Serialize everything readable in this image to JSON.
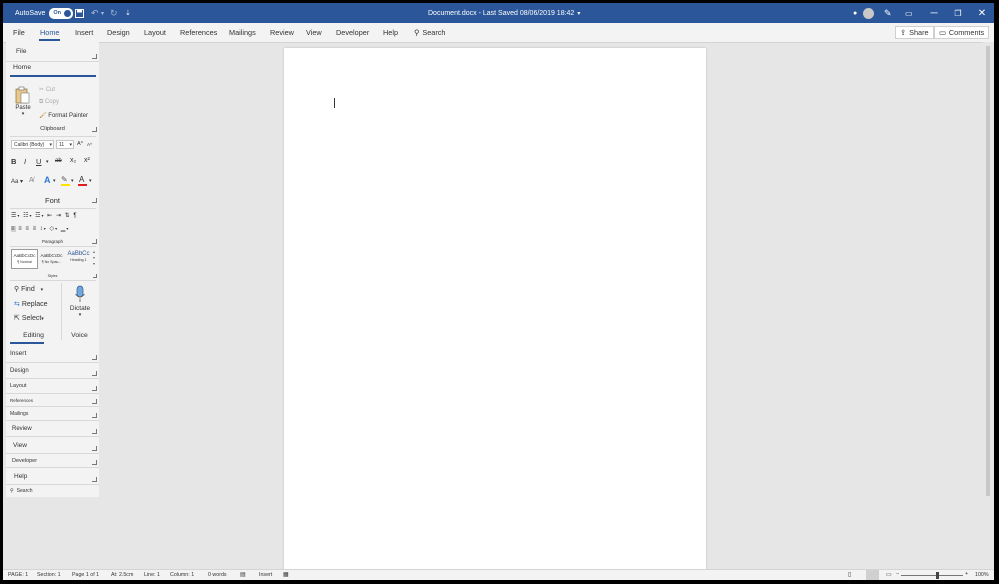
{
  "titlebar": {
    "autosave_label": "AutoSave",
    "autosave_state": "On",
    "document_title": "Document.docx - Last Saved 08/06/2019 18:42",
    "title_dropdown_icon": "chevron-down-icon",
    "avatar_initials": "",
    "buttons": [
      "minimize",
      "restore",
      "close"
    ]
  },
  "tabs": {
    "items": [
      "File",
      "Home",
      "Insert",
      "Design",
      "Layout",
      "References",
      "Mailings",
      "Review",
      "View",
      "Developer",
      "Help"
    ],
    "active": "Home",
    "search_label": "Search",
    "share_label": "Share",
    "comments_label": "Comments"
  },
  "ribbon": {
    "file_label": "File",
    "home_label": "Home",
    "clipboard": {
      "paste_label": "Paste",
      "cut_label": "Cut",
      "copy_label": "Copy",
      "format_painter_label": "Format Painter",
      "group_label": "Clipboard"
    },
    "font": {
      "font_name": "Calibri (Body)",
      "font_size": "11",
      "bold": "B",
      "italic": "I",
      "underline": "U",
      "strikethrough": "ab",
      "subscript": "x₂",
      "superscript": "x²",
      "change_case": "Aa",
      "text_effects": "A",
      "font_color": "A",
      "group_label": "Font",
      "grow_label": "A^",
      "shrink_label": "A^"
    },
    "paragraph": {
      "group_label": "Paragraph"
    },
    "styles": {
      "items": [
        {
          "preview": "AaBbCcDc",
          "name": "¶ Normal"
        },
        {
          "preview": "AaBbCcDc",
          "name": "¶ No Spac..."
        },
        {
          "preview": "AaBbCc",
          "name": "Heading 1"
        }
      ],
      "group_label": "Styles"
    },
    "editing": {
      "find_label": "Find",
      "replace_label": "Replace",
      "select_label": "Select",
      "group_label": "Editing"
    },
    "voice": {
      "dictate_label": "Dictate",
      "group_label": "Voice"
    },
    "collapsed_groups": [
      "Insert",
      "Design",
      "Layout",
      "References",
      "Mailings",
      "Review",
      "View",
      "Developer",
      "Help"
    ],
    "search_label": "Search"
  },
  "status": {
    "page": "PAGE: 1",
    "section": "Section: 1",
    "page_of": "Page 1 of 1",
    "at": "At: 2.5cm",
    "line": "Line: 1",
    "column": "Column: 1",
    "words": "0 words",
    "mode": "Insert",
    "zoom": "100%"
  },
  "colors": {
    "accent": "#2b579a",
    "ribbon_bg": "#f3f3f3",
    "canvas_bg": "#e6e6e6"
  }
}
